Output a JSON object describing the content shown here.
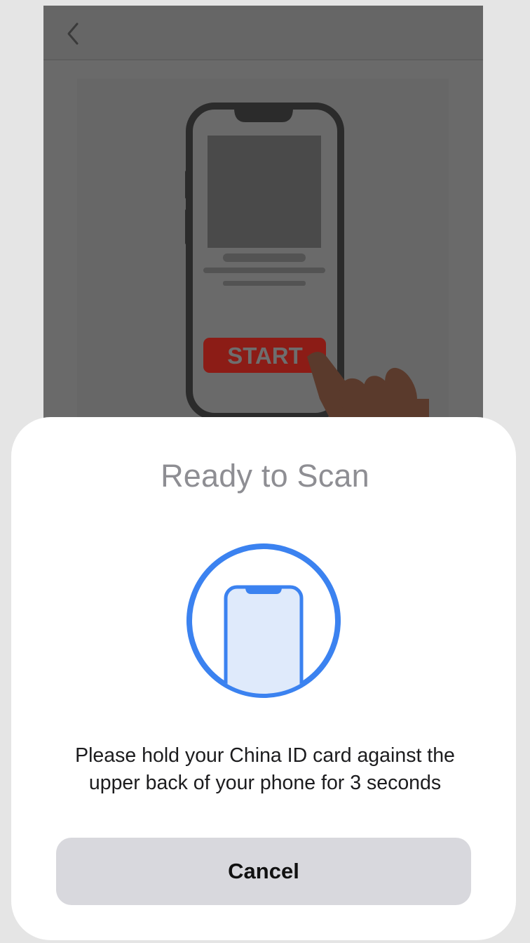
{
  "background_screen": {
    "nav": {
      "back_icon": "chevron-left-icon"
    },
    "illustration": {
      "button_label": "START",
      "button_color": "#8c1c16"
    }
  },
  "sheet": {
    "title": "Ready to Scan",
    "graphic_icon": "phone-scan-icon",
    "accent_color": "#3b82f0",
    "instructions_line1": "Please hold your China ID card against the",
    "instructions_line2": "upper back of your phone for 3 seconds",
    "cancel_label": "Cancel"
  }
}
